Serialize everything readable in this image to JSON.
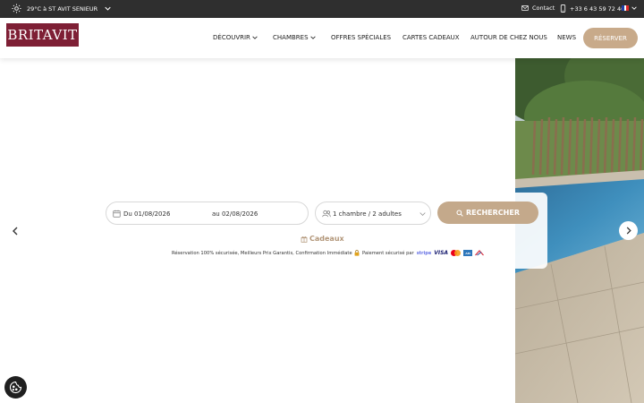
{
  "topbar": {
    "weather": "29°C à ST AVIT SENIEUR",
    "contact": "Contact",
    "phone": "+33 6 43 59 72 46",
    "language_flag_colors": [
      "#1f3fa6",
      "#ffffff",
      "#e02828"
    ]
  },
  "header": {
    "logo": "BRITAVIT",
    "nav": [
      {
        "label": "DÉCOUVRIR",
        "has_dropdown": true
      },
      {
        "label": "CHAMBRES",
        "has_dropdown": true
      },
      {
        "label": "OFFRES SPÉCIALES",
        "has_dropdown": false
      },
      {
        "label": "CARTES CADEAUX",
        "has_dropdown": false
      },
      {
        "label": "AUTOUR DE CHEZ NOUS",
        "has_dropdown": false
      },
      {
        "label": "NEWS",
        "has_dropdown": false
      }
    ],
    "reserve_label": "RÉSERVER"
  },
  "booking": {
    "date_from": "Du 01/08/2026",
    "date_to": "au 02/08/2026",
    "rooms_guests": "1 chambre / 2 adultes",
    "search_label": "RECHERCHER",
    "gifts_label": "Cadeaux",
    "secure_text": "Réservation 100% sécurisée, Meilleurs Prix Garantis, Confirmation Immédiate",
    "payment_text": "Paiement sécurisé par",
    "payment_methods": [
      "stripe",
      "VISA",
      "mastercard-icon",
      "amex-icon",
      "ancv-icon"
    ]
  },
  "colors": {
    "brand": "#7e1f35",
    "accent": "#c4a98b",
    "topbar": "#2f2f2f"
  }
}
